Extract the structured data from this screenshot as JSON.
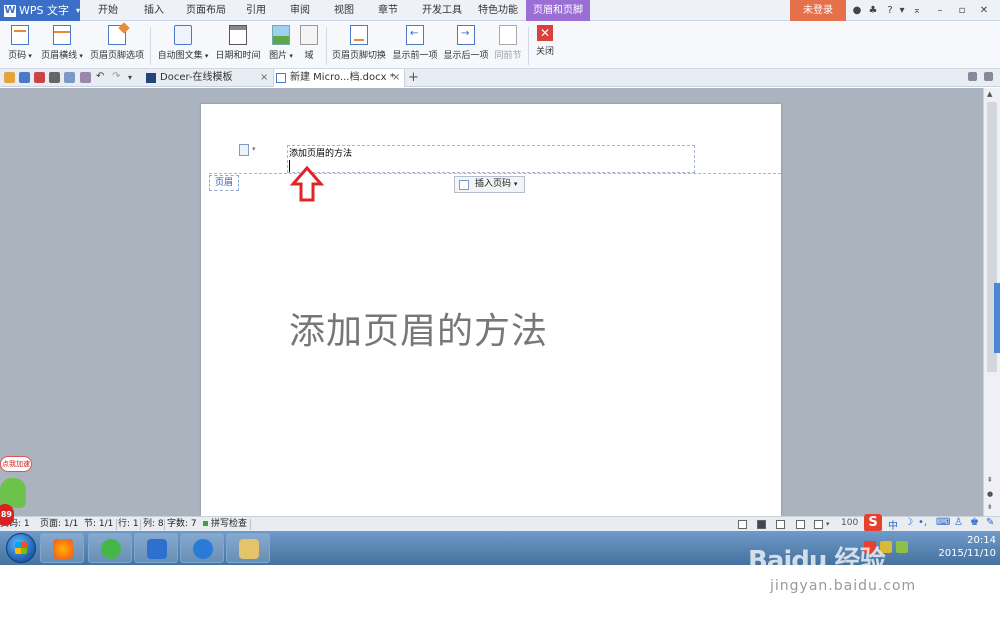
{
  "app": {
    "title": "WPS 文字"
  },
  "menu": {
    "tabs": [
      "开始",
      "插入",
      "页面布局",
      "引用",
      "审阅",
      "视图",
      "章节",
      "开发工具",
      "特色功能",
      "页眉和页脚"
    ],
    "login": "未登录",
    "help": "?"
  },
  "ribbon": {
    "page_number": "页码",
    "header_line": "页眉横线",
    "header_footer_options": "页眉页脚选项",
    "auto_text": "自动图文集",
    "date_time": "日期和时间",
    "picture": "图片",
    "field": "域",
    "switch": "页眉页脚切换",
    "show_prev": "显示前一项",
    "show_next": "显示后一项",
    "same_as_prev": "同前节",
    "close": "关闭"
  },
  "tabs": {
    "docer": "Docer-在线模板",
    "current": "新建 Micro...档.docx *",
    "close": "×",
    "new": "+"
  },
  "document": {
    "header_text": "添加页眉的方法",
    "header_label": "页眉",
    "insert_page_number": "插入页码",
    "body_text": "添加页眉的方法"
  },
  "status": {
    "page_num": "页码: 1",
    "pages": "页面: 1/1",
    "section": "节: 1/1",
    "row": "行: 1",
    "col": "列: 8",
    "chars": "字数: 7",
    "spell": "拼写检查",
    "zoom": "100"
  },
  "ime": {
    "label": "中"
  },
  "taskbar": {
    "time": "20:14",
    "date": "2015/11/10"
  },
  "widget": {
    "bubble": "点我加速",
    "badge": "89"
  },
  "watermark": {
    "logo": "Baidu 经验",
    "url": "jingyan.baidu.com"
  }
}
